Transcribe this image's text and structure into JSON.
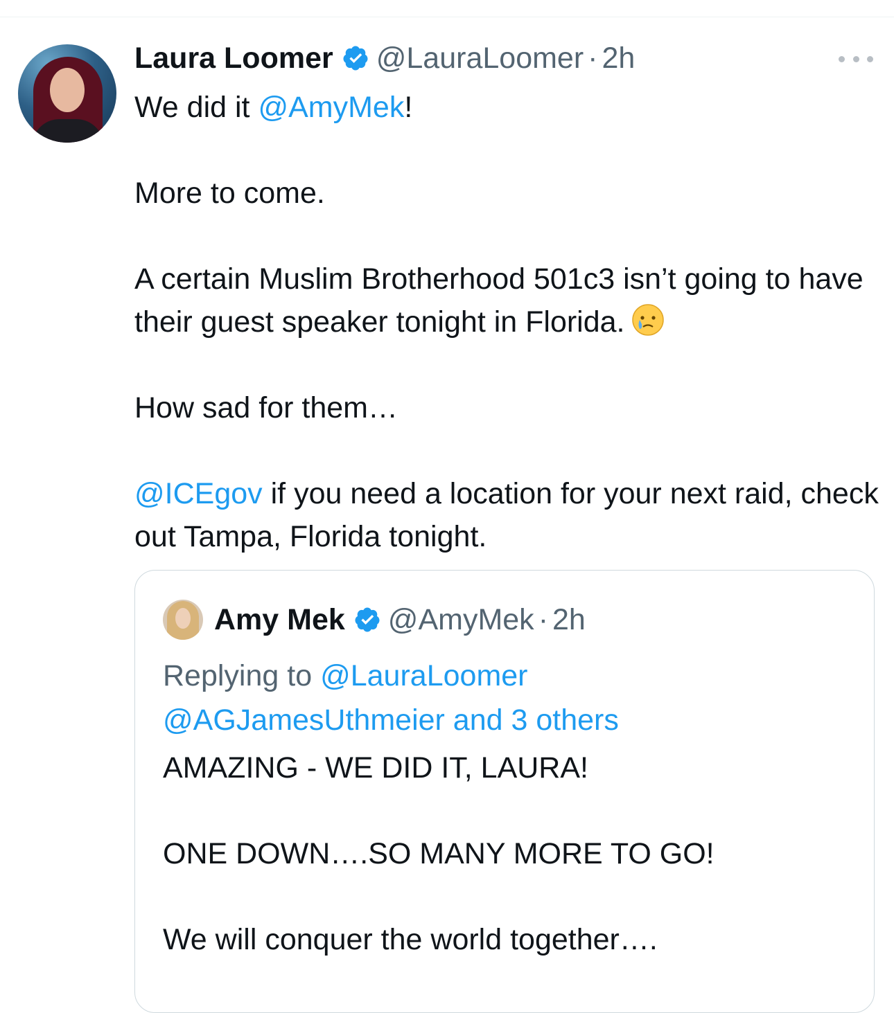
{
  "tweet": {
    "author_name": "Laura Loomer",
    "handle": "@LauraLoomer",
    "separator": "·",
    "time": "2h",
    "text_line1_prefix": "We did it ",
    "mention_1": "@AmyMek",
    "text_line1_suffix": "!",
    "paragraph_2": "More to come.",
    "paragraph_3": "A certain Muslim Brotherhood 501c3 isn’t going to have their guest speaker tonight in Florida.",
    "paragraph_4": "How sad for them…",
    "mention_2": "@ICEgov",
    "paragraph_5_suffix": " if you need a location for your next raid, check out Tampa, Florida tonight.",
    "emoji": "face-holding-back-tears"
  },
  "quoted_tweet": {
    "author_name": "Amy Mek",
    "handle": "@AmyMek",
    "separator": "·",
    "time": "2h",
    "replying_prefix": "Replying to ",
    "replying_to": "@LauraLoomer",
    "replying_others": "@AGJamesUthmeier and 3 others",
    "paragraph_1": "AMAZING - WE DID IT, LAURA!",
    "paragraph_2": "ONE DOWN….SO MANY MORE TO GO!",
    "paragraph_3": "We will conquer the world together…."
  },
  "colors": {
    "link": "#1d9bf0",
    "secondary_text": "#536471",
    "verified_badge": "#1d9bf0"
  }
}
